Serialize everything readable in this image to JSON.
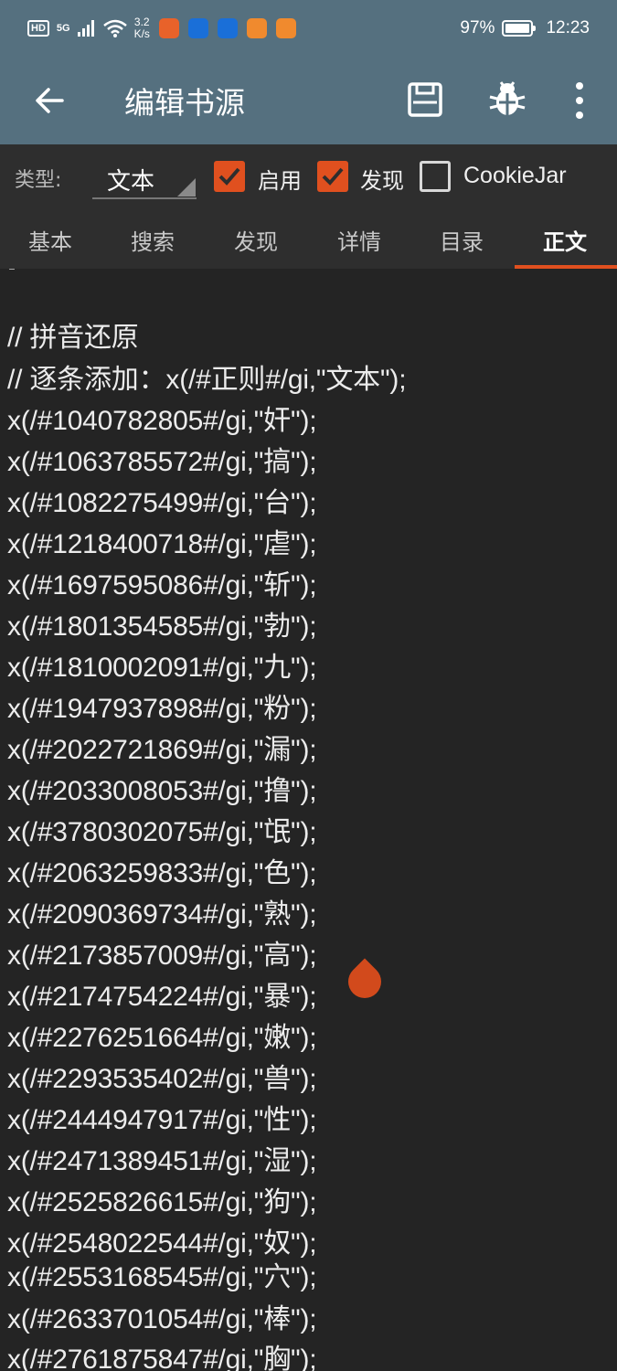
{
  "status_bar": {
    "hd": "HD",
    "signal": "5G",
    "speed_value": "3.2",
    "speed_unit": "K/s",
    "battery": "97%",
    "battery_level": 0.97,
    "time": "12:23"
  },
  "app_bar": {
    "title": "编辑书源",
    "icons": [
      "back-arrow-icon",
      "save-icon",
      "bug-icon",
      "more-vert-icon"
    ]
  },
  "options": {
    "type_label": "类型:",
    "type_value": "文本",
    "enable_label": "启用",
    "enable_checked": true,
    "discover_label": "发现",
    "discover_checked": true,
    "cookie_label": "CookieJar",
    "cookie_checked": false
  },
  "tabs": [
    "基本",
    "搜索",
    "发现",
    "详情",
    "目录",
    "正文"
  ],
  "active_tab": "正文",
  "editor": {
    "lines": [
      "// 拼音还原",
      "// 逐条添加：x(/#正则#/gi,\"文本\");",
      "x(/#1040782805#/gi,\"奸\");",
      "x(/#1063785572#/gi,\"搞\");",
      "x(/#1082275499#/gi,\"台\");",
      "x(/#1218400718#/gi,\"虐\");",
      "x(/#1697595086#/gi,\"斩\");",
      "x(/#1801354585#/gi,\"勃\");",
      "x(/#1810002091#/gi,\"九\");",
      "x(/#1947937898#/gi,\"粉\");",
      "x(/#2022721869#/gi,\"漏\");",
      "x(/#2033008053#/gi,\"撸\");",
      "x(/#3780302075#/gi,\"氓\");",
      "x(/#2063259833#/gi,\"色\");",
      "x(/#2090369734#/gi,\"熟\");",
      "x(/#2173857009#/gi,\"高\");",
      "x(/#2174754224#/gi,\"暴\");",
      "x(/#2276251664#/gi,\"嫩\");",
      "x(/#2293535402#/gi,\"兽\");",
      "x(/#2444947917#/gi,\"性\");",
      "x(/#2471389451#/gi,\"湿\");",
      "x(/#2525826615#/gi,\"狗\");",
      "x(/#2548022544#/gi,\"奴\");",
      "x(/#2553168545#/gi,\"穴\");",
      "x(/#2633701054#/gi,\"棒\");",
      "x(/#2761875847#/gi,\"胸\");"
    ]
  },
  "colors": {
    "app_bar": "#55707f",
    "accent": "#e0501f",
    "editor_bg": "#242424"
  }
}
